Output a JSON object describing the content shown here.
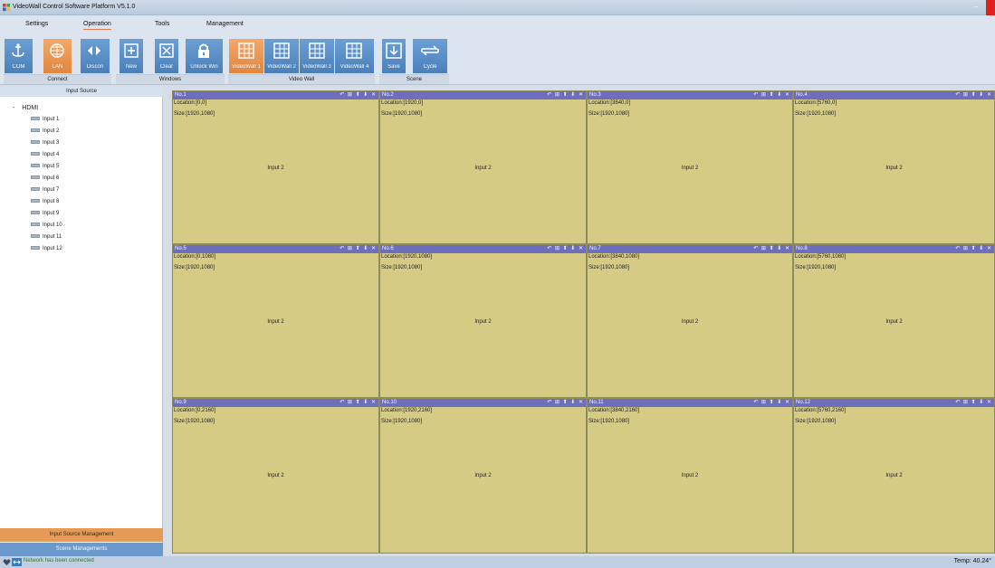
{
  "window": {
    "title": "VideoWall Control Software Platform V5.1.0",
    "minimize_glyph": "–"
  },
  "menu": {
    "tabs": [
      "Settings",
      "Operation",
      "Tools",
      "Management"
    ],
    "active": "Operation"
  },
  "ribbon": {
    "buttons": [
      {
        "label": "COM",
        "icon": "anchor-icon",
        "active": false
      },
      {
        "label": "LAN",
        "icon": "globe-icon",
        "active": true
      },
      {
        "label": "Discon",
        "icon": "disconnect-icon",
        "active": false
      },
      {
        "label": "New",
        "icon": "new-window-icon",
        "active": false
      },
      {
        "label": "Clear",
        "icon": "clear-icon",
        "active": false
      },
      {
        "label": "Unlock Win",
        "icon": "lock-icon",
        "active": false
      },
      {
        "label": "VideoWall 1",
        "icon": "grid-icon",
        "active": true
      },
      {
        "label": "VideoWall 2",
        "icon": "grid-icon",
        "active": false
      },
      {
        "label": "VideoWall 3",
        "icon": "grid-icon",
        "active": false
      },
      {
        "label": "VideoWall 4",
        "icon": "grid-icon",
        "active": false
      },
      {
        "label": "Save",
        "icon": "save-icon",
        "active": false
      },
      {
        "label": "Cycle",
        "icon": "cycle-icon",
        "active": false
      }
    ],
    "groups": [
      "Connect",
      "Windows",
      "Video Wall",
      "Scene"
    ]
  },
  "input_source": {
    "header": "Input Source",
    "root": "HDMI",
    "root_toggle": "-",
    "items": [
      "Input 1",
      "Input 2",
      "Input 3",
      "Input 4",
      "Input 5",
      "Input 6",
      "Input 7",
      "Input 8",
      "Input 9",
      "Input 10",
      "Input 11",
      "Input 12"
    ],
    "buttons": [
      "Input Source Management",
      "Scene Managements"
    ]
  },
  "wall": {
    "tool_glyphs": "↶ ⊞ ⬆ ⬇ ✕",
    "cells": [
      {
        "no": "No.1",
        "location": "Location:[0,0]",
        "size": "Size:[1920,1080]",
        "source": "Input 2"
      },
      {
        "no": "No.2",
        "location": "Location:[1920,0]",
        "size": "Size:[1920,1080]",
        "source": "Input 2"
      },
      {
        "no": "No.3",
        "location": "Location:[3840,0]",
        "size": "Size:[1920,1080]",
        "source": "Input 2"
      },
      {
        "no": "No.4",
        "location": "Location:[5760,0]",
        "size": "Size:[1920,1080]",
        "source": "Input 2"
      },
      {
        "no": "No.5",
        "location": "Location:[0,1080]",
        "size": "Size:[1920,1080]",
        "source": "Input 2"
      },
      {
        "no": "No.6",
        "location": "Location:[1920,1080]",
        "size": "Size:[1920,1080]",
        "source": "Input 2"
      },
      {
        "no": "No.7",
        "location": "Location:[3840,1080]",
        "size": "Size:[1920,1080]",
        "source": "Input 2"
      },
      {
        "no": "No.8",
        "location": "Location:[5760,1080]",
        "size": "Size:[1920,1080]",
        "source": "Input 2"
      },
      {
        "no": "No.9",
        "location": "Location:[0,2160]",
        "size": "Size:[1920,1080]",
        "source": "Input 2"
      },
      {
        "no": "No.10",
        "location": "Location:[1920,2160]",
        "size": "Size:[1920,1080]",
        "source": "Input 2"
      },
      {
        "no": "No.11",
        "location": "Location:[3840,2160]",
        "size": "Size:[1920,1080]",
        "source": "Input 2"
      },
      {
        "no": "No.12",
        "location": "Location:[5760,2160]",
        "size": "Size:[1920,1080]",
        "source": "Input 2"
      }
    ]
  },
  "status": {
    "message": "Network has been connected",
    "temp": "Temp: 40.24°"
  },
  "colors": {
    "ribbon_button": "#5b8ec8",
    "ribbon_active": "#ea944f",
    "cell_bg": "#d6cb84",
    "cell_header": "#6d6fbd",
    "close_red": "#e0201c"
  }
}
